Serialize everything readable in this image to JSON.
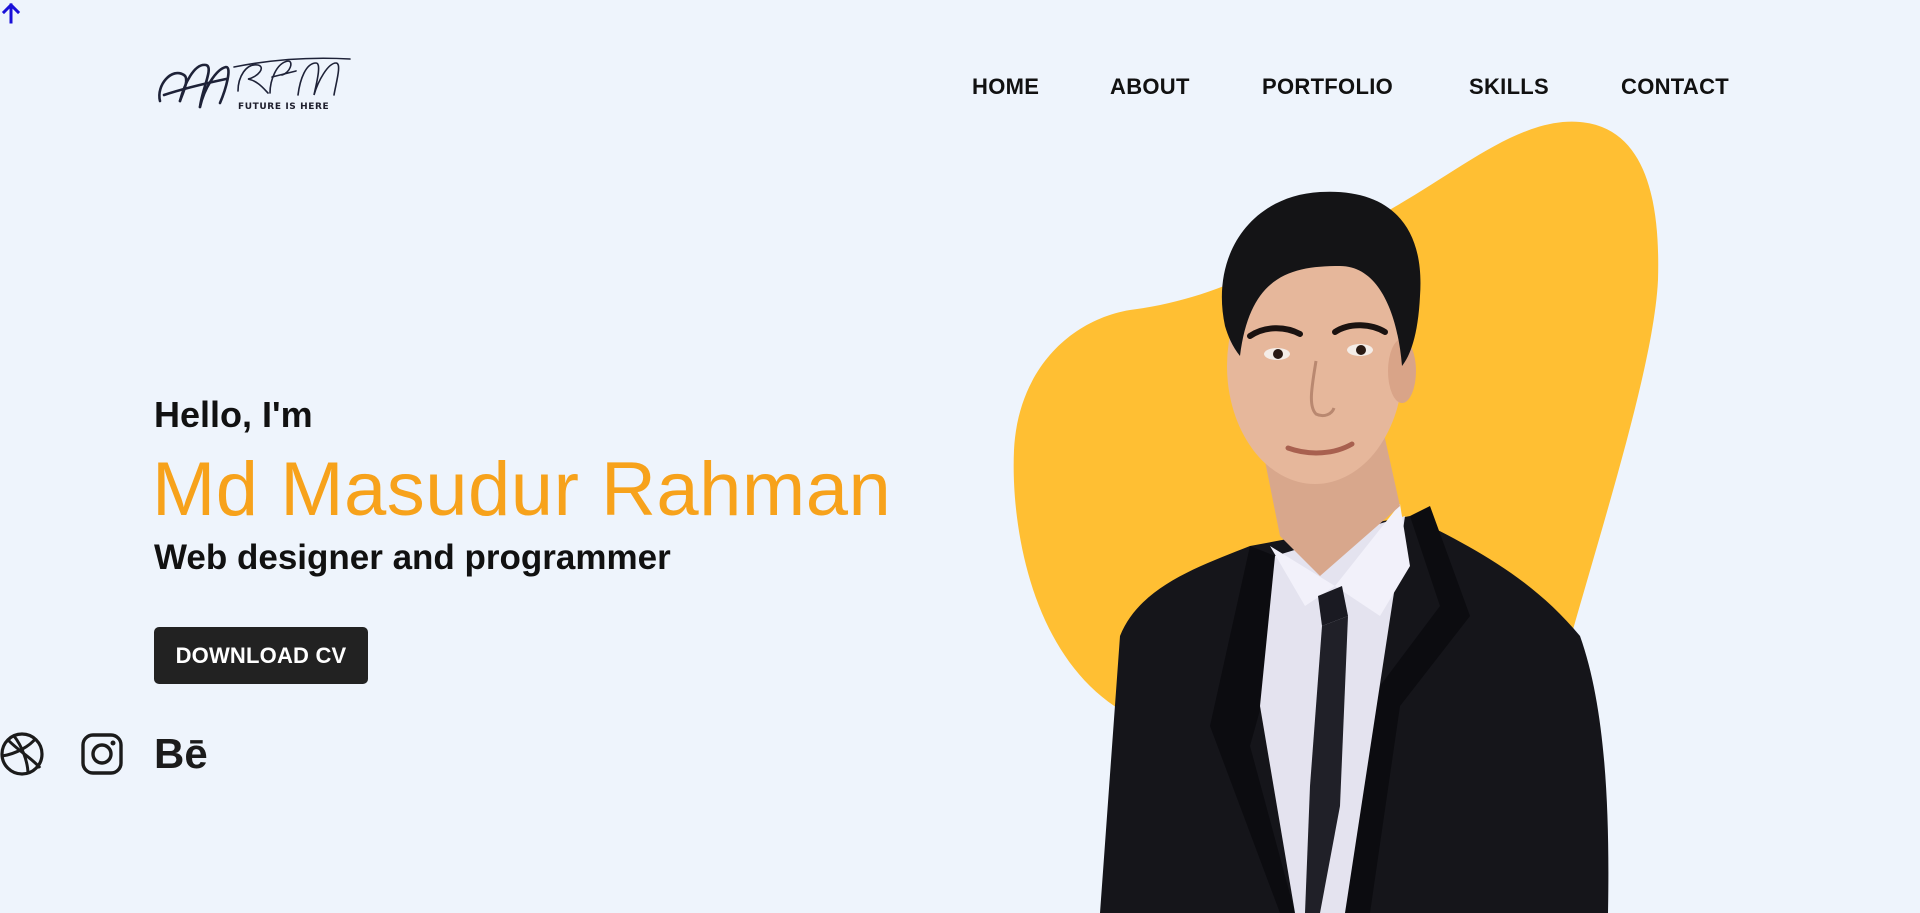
{
  "header": {
    "logo": {
      "monogram": "MRM",
      "tagline": "FUTURE IS HERE"
    },
    "nav": [
      {
        "label": "HOME"
      },
      {
        "label": "ABOUT"
      },
      {
        "label": "PORTFOLIO"
      },
      {
        "label": "SKILLS"
      },
      {
        "label": "CONTACT"
      }
    ]
  },
  "hero": {
    "greeting": "Hello, I'm",
    "name": "Md Masudur Rahman",
    "role": "Web designer and programmer",
    "cta_label": "DOWNLOAD CV",
    "social": [
      {
        "icon": "dribbble-icon"
      },
      {
        "icon": "instagram-icon"
      },
      {
        "icon": "behance-icon",
        "glyph": "Bē"
      }
    ]
  },
  "colors": {
    "background": "#eef4fc",
    "accent": "#f7a21b",
    "blob": "#ffbf33",
    "button_bg": "#222222",
    "scroll_top_arrow": "#1a10d8"
  }
}
